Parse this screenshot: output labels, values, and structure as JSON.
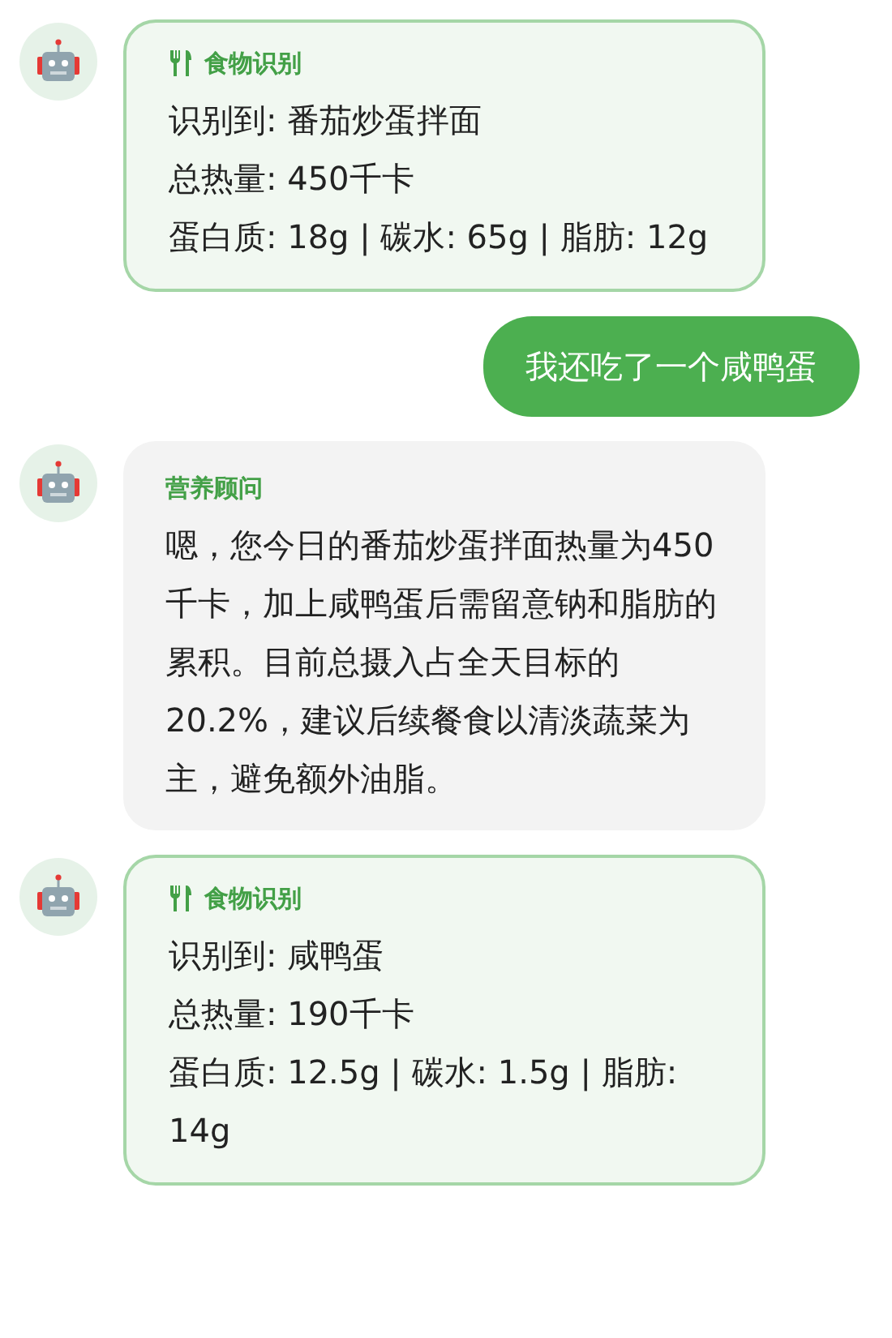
{
  "messages": [
    {
      "kind": "food",
      "title": "食物识别",
      "lines": [
        "识别到: 番茄炒蛋拌面",
        "总热量: 450千卡",
        "蛋白质: 18g | 碳水: 65g | 脂肪: 12g"
      ]
    },
    {
      "kind": "user",
      "text": "我还吃了一个咸鸭蛋"
    },
    {
      "kind": "advice",
      "title": "营养顾问",
      "text": "嗯，您今日的番茄炒蛋拌面热量为450千卡，加上咸鸭蛋后需留意钠和脂肪的累积。目前总摄入占全天目标的20.2%，建议后续餐食以清淡蔬菜为主，避免额外油脂。"
    },
    {
      "kind": "food",
      "title": "食物识别",
      "lines": [
        "识别到: 咸鸭蛋",
        "总热量: 190千卡",
        "蛋白质: 12.5g | 碳水: 1.5g | 脂肪: 14g"
      ]
    }
  ]
}
